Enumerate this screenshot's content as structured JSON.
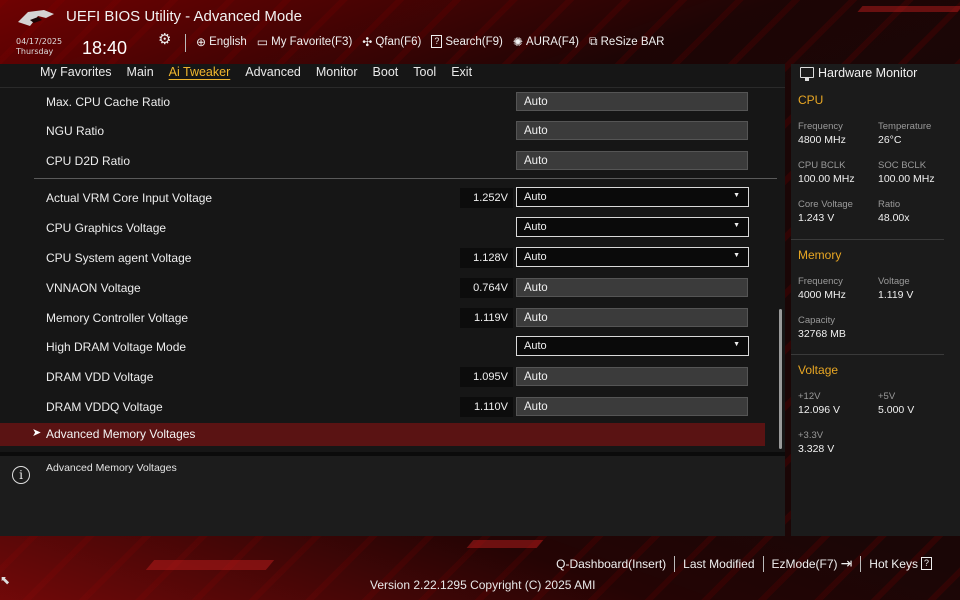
{
  "header": {
    "title": "UEFI BIOS Utility - Advanced Mode",
    "date": "04/17/2025",
    "weekday": "Thursday",
    "time": "18:40",
    "toolbar": [
      {
        "icon": "globe-icon",
        "glyph": "⊕",
        "label": "English"
      },
      {
        "icon": "favorite-icon",
        "glyph": "▭",
        "label": "My Favorite(F3)"
      },
      {
        "icon": "fan-icon",
        "glyph": "✣",
        "label": "Qfan(F6)"
      },
      {
        "icon": "search-icon",
        "glyph": "?",
        "label": "Search(F9)"
      },
      {
        "icon": "aura-icon",
        "glyph": "✺",
        "label": "AURA(F4)"
      },
      {
        "icon": "resize-bar-icon",
        "glyph": "⧉",
        "label": "ReSize BAR"
      }
    ]
  },
  "nav": {
    "tabs": [
      "My Favorites",
      "Main",
      "Ai Tweaker",
      "Advanced",
      "Monitor",
      "Boot",
      "Tool",
      "Exit"
    ],
    "active": "Ai Tweaker"
  },
  "settings": [
    {
      "label": "Max. CPU Cache Ratio",
      "reading": "",
      "value": "Auto",
      "control": "field"
    },
    {
      "label": "NGU Ratio",
      "reading": "",
      "value": "Auto",
      "control": "field"
    },
    {
      "label": "CPU D2D Ratio",
      "reading": "",
      "value": "Auto",
      "control": "field"
    },
    {
      "label": "Actual VRM Core Input Voltage",
      "reading": "1.252V",
      "value": "Auto",
      "control": "dropdown"
    },
    {
      "label": "CPU Graphics Voltage",
      "reading": "",
      "value": "Auto",
      "control": "dropdown"
    },
    {
      "label": "CPU System agent Voltage",
      "reading": "1.128V",
      "value": "Auto",
      "control": "dropdown"
    },
    {
      "label": "VNNAON Voltage",
      "reading": "0.764V",
      "value": "Auto",
      "control": "field"
    },
    {
      "label": "Memory Controller Voltage",
      "reading": "1.119V",
      "value": "Auto",
      "control": "field"
    },
    {
      "label": "High DRAM Voltage Mode",
      "reading": "",
      "value": "Auto",
      "control": "dropdown"
    },
    {
      "label": "DRAM VDD Voltage",
      "reading": "1.095V",
      "value": "Auto",
      "control": "field"
    },
    {
      "label": "DRAM VDDQ Voltage",
      "reading": "1.110V",
      "value": "Auto",
      "control": "field"
    }
  ],
  "submenu": {
    "arrow": "➤",
    "label": "Advanced Memory Voltages"
  },
  "help": {
    "icon_glyph": "i",
    "text": "Advanced Memory Voltages"
  },
  "hardware_monitor": {
    "title": "Hardware Monitor",
    "cpu": {
      "title": "CPU",
      "items": [
        {
          "key": "Frequency",
          "value": "4800 MHz"
        },
        {
          "key": "Temperature",
          "value": "26°C"
        },
        {
          "key": "CPU BCLK",
          "value": "100.00 MHz"
        },
        {
          "key": "SOC BCLK",
          "value": "100.00 MHz"
        },
        {
          "key": "Core Voltage",
          "value": "1.243 V"
        },
        {
          "key": "Ratio",
          "value": "48.00x"
        }
      ]
    },
    "memory": {
      "title": "Memory",
      "items": [
        {
          "key": "Frequency",
          "value": "4000 MHz"
        },
        {
          "key": "Voltage",
          "value": "1.119 V"
        },
        {
          "key": "Capacity",
          "value": "32768 MB"
        }
      ]
    },
    "voltage": {
      "title": "Voltage",
      "items": [
        {
          "key": "+12V",
          "value": "12.096 V"
        },
        {
          "key": "+5V",
          "value": "5.000 V"
        },
        {
          "key": "+3.3V",
          "value": "3.328 V"
        }
      ]
    }
  },
  "footer": {
    "links": [
      "Q-Dashboard(Insert)",
      "Last Modified",
      "EzMode(F7)",
      "Hot Keys"
    ],
    "ezmode_glyph": "⇥",
    "hotkeys_glyph": "?",
    "copyright": "Version 2.22.1295 Copyright (C) 2025 AMI"
  },
  "colors": {
    "accent": "#e8a623",
    "active_tab": "#f1b72e",
    "selected_row": "#5a1313"
  }
}
